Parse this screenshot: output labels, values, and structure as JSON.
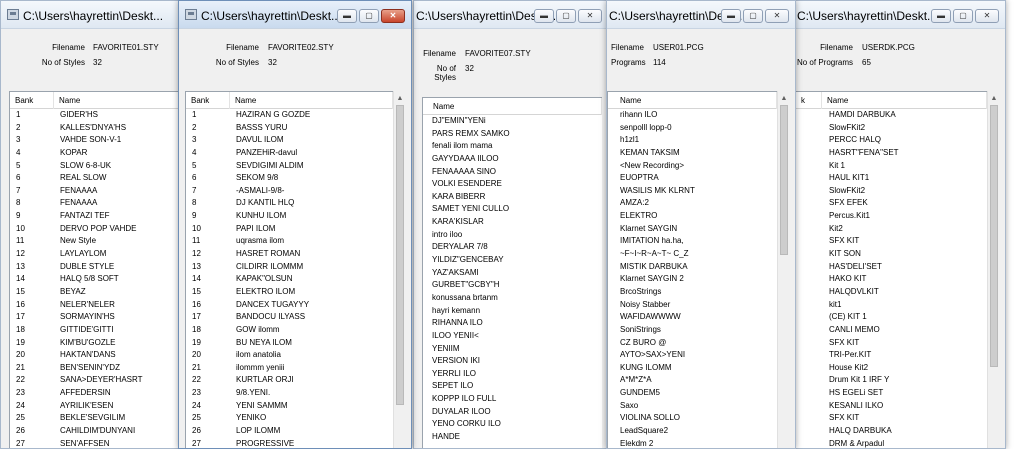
{
  "windows": [
    {
      "id": "w1",
      "title": "C:\\Users\\hayrettin\\Deskt...",
      "info": [
        {
          "label": "Filename",
          "value": "FAVORITE01.STY"
        },
        {
          "label": "No of Styles",
          "value": "32"
        }
      ],
      "columns": {
        "bank": "Bank",
        "name": "Name"
      },
      "rows": [
        {
          "bank": "1",
          "name": "GIDER'HS"
        },
        {
          "bank": "2",
          "name": "KALLES'DNYA'HS"
        },
        {
          "bank": "3",
          "name": "VAHDE SON-V-1"
        },
        {
          "bank": "4",
          "name": "KOPAR"
        },
        {
          "bank": "5",
          "name": "SLOW 6-8-UK"
        },
        {
          "bank": "6",
          "name": "REAL SLOW"
        },
        {
          "bank": "7",
          "name": "FENAAAA"
        },
        {
          "bank": "8",
          "name": "FENAAAA"
        },
        {
          "bank": "9",
          "name": "FANTAZI TEF"
        },
        {
          "bank": "10",
          "name": "DERVO POP VAHDE"
        },
        {
          "bank": "11",
          "name": "New Style"
        },
        {
          "bank": "12",
          "name": "LAYLAYLOM"
        },
        {
          "bank": "13",
          "name": "DUBLE STYLE"
        },
        {
          "bank": "14",
          "name": "HALQ 5/8 SOFT"
        },
        {
          "bank": "15",
          "name": "BEYAZ"
        },
        {
          "bank": "16",
          "name": "NELER'NELER"
        },
        {
          "bank": "17",
          "name": "SORMAYIN'HS"
        },
        {
          "bank": "18",
          "name": "GITTIDE'GITTI"
        },
        {
          "bank": "19",
          "name": "KIM'BU'GOZLE"
        },
        {
          "bank": "20",
          "name": "HAKTAN'DANS"
        },
        {
          "bank": "21",
          "name": "BEN'SENIN'YDZ"
        },
        {
          "bank": "22",
          "name": "SANA>DEYER'HASRT"
        },
        {
          "bank": "23",
          "name": "AFFEDERSIN"
        },
        {
          "bank": "24",
          "name": "AYRILIK'ESEN"
        },
        {
          "bank": "25",
          "name": "BEKLE'SEVGILIM"
        },
        {
          "bank": "26",
          "name": "CAHILDIM'DUNYANI"
        },
        {
          "bank": "27",
          "name": "SEN'AFFSEN"
        }
      ]
    },
    {
      "id": "w2",
      "title": "C:\\Users\\hayrettin\\Deskt...",
      "info": [
        {
          "label": "Filename",
          "value": "FAVORITE02.STY"
        },
        {
          "label": "No of Styles",
          "value": "32"
        }
      ],
      "columns": {
        "bank": "Bank",
        "name": "Name"
      },
      "rows": [
        {
          "bank": "1",
          "name": "HAZIRAN G GOZDE"
        },
        {
          "bank": "2",
          "name": "BASSS YURU"
        },
        {
          "bank": "3",
          "name": "DAVUL ILOM"
        },
        {
          "bank": "4",
          "name": "PANZEHiR-davul"
        },
        {
          "bank": "5",
          "name": "SEVDIGIMI ALDIM"
        },
        {
          "bank": "6",
          "name": "SEKOM 9/8"
        },
        {
          "bank": "7",
          "name": "-ASMALI-9/8-"
        },
        {
          "bank": "8",
          "name": "DJ KANTIL HLQ"
        },
        {
          "bank": "9",
          "name": "KUNHU ILOM"
        },
        {
          "bank": "10",
          "name": "PAPI ILOM"
        },
        {
          "bank": "11",
          "name": "uqrasma ilom"
        },
        {
          "bank": "12",
          "name": "HASRET ROMAN"
        },
        {
          "bank": "13",
          "name": "CILDIRR ILOMMM"
        },
        {
          "bank": "14",
          "name": "KAPAK\"OLSUN"
        },
        {
          "bank": "15",
          "name": "ELEKTRO ILOM"
        },
        {
          "bank": "16",
          "name": "DANCEX TUGAYYY"
        },
        {
          "bank": "17",
          "name": "BANDOCU ILYASS"
        },
        {
          "bank": "18",
          "name": "GOW ilomm"
        },
        {
          "bank": "19",
          "name": "BU NEYA ILOM"
        },
        {
          "bank": "20",
          "name": "ilom anatolia"
        },
        {
          "bank": "21",
          "name": "ilommm yeniii"
        },
        {
          "bank": "22",
          "name": "KURTLAR ORJI"
        },
        {
          "bank": "23",
          "name": "9/8.YENI."
        },
        {
          "bank": "24",
          "name": "YENI SAMMM"
        },
        {
          "bank": "25",
          "name": "YENIKO"
        },
        {
          "bank": "26",
          "name": "LOP ILOMM"
        },
        {
          "bank": "27",
          "name": "PROGRESSIVE"
        }
      ]
    },
    {
      "id": "w3",
      "title": "C:\\Users\\hayrettin\\Deskt...",
      "info": [
        {
          "label": "Filename",
          "value": "FAVORITE07.STY"
        },
        {
          "label": "No of Styles",
          "value": "32"
        }
      ],
      "columns": {
        "bank": "",
        "name": "Name"
      },
      "rows": [
        {
          "bank": "",
          "name": "DJ\"EMIN\"YENi"
        },
        {
          "bank": "",
          "name": "PARS REMX SAMKO"
        },
        {
          "bank": "",
          "name": "fenali ilom mama"
        },
        {
          "bank": "",
          "name": "GAYYDAAA IILOO"
        },
        {
          "bank": "",
          "name": "FENAAAAA SINO"
        },
        {
          "bank": "",
          "name": "VOLKI ESENDERE"
        },
        {
          "bank": "",
          "name": "KARA BIBERR"
        },
        {
          "bank": "",
          "name": "SAMET YENI CULLO"
        },
        {
          "bank": "",
          "name": "KARA'KISLAR"
        },
        {
          "bank": "",
          "name": "intro iloo"
        },
        {
          "bank": "",
          "name": "DERYALAR 7/8"
        },
        {
          "bank": "",
          "name": "YILDIZ\"GENCEBAY"
        },
        {
          "bank": "",
          "name": "YAZ'AKSAMI"
        },
        {
          "bank": "",
          "name": "GURBET\"GCBY\"H"
        },
        {
          "bank": "",
          "name": "konussana brtanm"
        },
        {
          "bank": "",
          "name": "hayri kemann"
        },
        {
          "bank": "",
          "name": "RIHANNA ILO"
        },
        {
          "bank": "",
          "name": "ILOO YENII<"
        },
        {
          "bank": "",
          "name": "YENIIM"
        },
        {
          "bank": "",
          "name": "VERSION IKI"
        },
        {
          "bank": "",
          "name": "YERRLI ILO"
        },
        {
          "bank": "",
          "name": "SEPET ILO"
        },
        {
          "bank": "",
          "name": "KOPPP ILO FULL"
        },
        {
          "bank": "",
          "name": "DUYALAR ILOO"
        },
        {
          "bank": "",
          "name": "YENO CORKU ILO"
        },
        {
          "bank": "",
          "name": "HANDE"
        }
      ]
    },
    {
      "id": "w4",
      "title": "C:\\Users\\hayrettin\\Deskt...",
      "info": [
        {
          "label": "Filename",
          "value": "USER01.PCG"
        },
        {
          "label": "Programs",
          "value": "114"
        }
      ],
      "columns": {
        "bank": "",
        "name": "Name"
      },
      "rows": [
        {
          "bank": "",
          "name": "rihann ILO"
        },
        {
          "bank": "",
          "name": "senpolll lopp-0"
        },
        {
          "bank": "",
          "name": "h1zl1"
        },
        {
          "bank": "",
          "name": "KEMAN TAKSIM"
        },
        {
          "bank": "",
          "name": "<New Recording>"
        },
        {
          "bank": "",
          "name": "EUOPTRA"
        },
        {
          "bank": "",
          "name": "WASILIS MK KLRNT"
        },
        {
          "bank": "",
          "name": "AMZA:2"
        },
        {
          "bank": "",
          "name": "ELEKTRO"
        },
        {
          "bank": "",
          "name": "Klarnet SAYGIN"
        },
        {
          "bank": "",
          "name": "IMITATION ha.ha,"
        },
        {
          "bank": "",
          "name": "~F~I~R~A~T~ C_Z"
        },
        {
          "bank": "",
          "name": "MISTIK DARBUKA"
        },
        {
          "bank": "",
          "name": "Klarnet SAYGIN 2"
        },
        {
          "bank": "",
          "name": "BrcoStrings"
        },
        {
          "bank": "",
          "name": "Noisy Stabber"
        },
        {
          "bank": "",
          "name": "WAFIDAWWWW"
        },
        {
          "bank": "",
          "name": "SoniStrings"
        },
        {
          "bank": "",
          "name": "CZ BURO @"
        },
        {
          "bank": "",
          "name": "AYTO>SAX>YENI"
        },
        {
          "bank": "",
          "name": "KUNG ILOMM"
        },
        {
          "bank": "",
          "name": "A*M*Z*A"
        },
        {
          "bank": "",
          "name": "GUNDEM5"
        },
        {
          "bank": "",
          "name": "Saxo"
        },
        {
          "bank": "",
          "name": "VIOLINA SOLLO"
        },
        {
          "bank": "",
          "name": "LeadSquare2"
        },
        {
          "bank": "",
          "name": "Elekdm 2"
        }
      ]
    },
    {
      "id": "w5",
      "title": "C:\\Users\\hayrettin\\Deskt...",
      "info": [
        {
          "label": "Filename",
          "value": "USERDK.PCG"
        },
        {
          "label": "No of Programs",
          "value": "65"
        }
      ],
      "columns": {
        "bank": "k",
        "name": "Name"
      },
      "rows": [
        {
          "bank": "",
          "name": "HAMDI DARBUKA"
        },
        {
          "bank": "",
          "name": "SlowFKit2"
        },
        {
          "bank": "",
          "name": "PERCC HALQ"
        },
        {
          "bank": "",
          "name": "HASRT\"FENA\"SET"
        },
        {
          "bank": "",
          "name": "Kit 1"
        },
        {
          "bank": "",
          "name": "HAUL KIT1"
        },
        {
          "bank": "",
          "name": "SlowFKit2"
        },
        {
          "bank": "",
          "name": "SFX EFEK"
        },
        {
          "bank": "",
          "name": "Percus.Kit1"
        },
        {
          "bank": "",
          "name": "Kit2"
        },
        {
          "bank": "",
          "name": "SFX KIT"
        },
        {
          "bank": "",
          "name": "KIT SON"
        },
        {
          "bank": "",
          "name": "HAS'DELI'SET"
        },
        {
          "bank": "",
          "name": "HAKO KIT"
        },
        {
          "bank": "",
          "name": "HALQDVLKIT"
        },
        {
          "bank": "",
          "name": "kit1"
        },
        {
          "bank": "",
          "name": "(CE) KIT 1"
        },
        {
          "bank": "",
          "name": "CANLI MEMO"
        },
        {
          "bank": "",
          "name": "SFX KIT"
        },
        {
          "bank": "",
          "name": "TRI-Per.KIT"
        },
        {
          "bank": "",
          "name": "House Kit2"
        },
        {
          "bank": "",
          "name": "Drum Kit 1 IRF Y"
        },
        {
          "bank": "",
          "name": "HS EGELi SET"
        },
        {
          "bank": "",
          "name": "KESANLI ILKO"
        },
        {
          "bank": "",
          "name": "SFX KIT"
        },
        {
          "bank": "",
          "name": "HALQ DARBUKA"
        },
        {
          "bank": "",
          "name": "DRM & Arpadul"
        }
      ]
    }
  ]
}
